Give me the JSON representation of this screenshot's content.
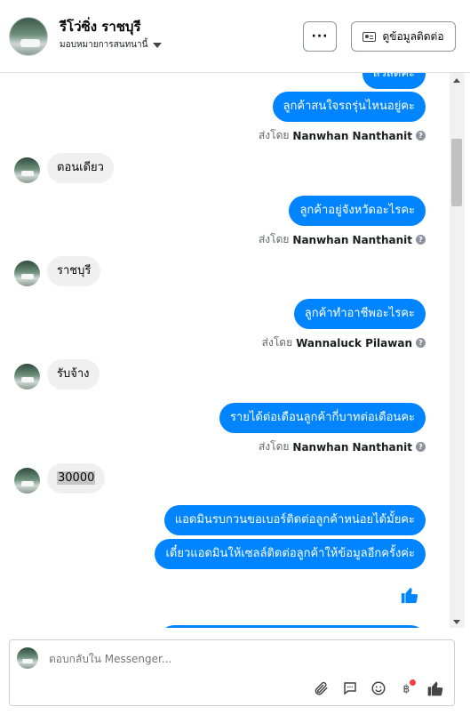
{
  "header": {
    "contact_name": "รีโว่ซิ่ง ราชบุรี",
    "assign_label": "มอบหมายการสนทนานี้",
    "more_label": "···",
    "contact_info_label": "ดูข้อมูลติดต่อ"
  },
  "thread": {
    "sent_by_prefix": "ส่งโดย",
    "messages": [
      {
        "id": "m0",
        "text": "สวัสดีค่ะ"
      },
      {
        "id": "m1",
        "text": "ลูกค้าสนใจรถรุ่นไหนอยู่คะ",
        "sender": "Nanwhan Nanthanit"
      },
      {
        "id": "m2",
        "text": "ตอนเดียว"
      },
      {
        "id": "m3",
        "text": "ลูกค้าอยู่จังหวัดอะไรคะ",
        "sender": "Nanwhan Nanthanit"
      },
      {
        "id": "m4",
        "text": "ราชบุรี"
      },
      {
        "id": "m5",
        "text": "ลูกค้าทำอาชีพอะไรคะ",
        "sender": "Wannaluck Pilawan"
      },
      {
        "id": "m6",
        "text": "รับจ้าง"
      },
      {
        "id": "m7",
        "text": "รายได้ต่อเดือนลูกค้ากี่บาทต่อเดือนคะ",
        "sender": "Nanwhan Nanthanit"
      },
      {
        "id": "m8",
        "text": "30000"
      },
      {
        "id": "m9",
        "text": "แอดมินรบกวนขอเบอร์ติดต่อลูกค้าหน่อยได้มั้ยคะ"
      },
      {
        "id": "m10",
        "text": "เดี๋ยวแอดมินให้เซลล์ติดต่อลูกค้าให้ข้อมูลอีกครั้งค่ะ"
      }
    ]
  },
  "composer": {
    "placeholder": "ตอบกลับใน Messenger..."
  },
  "colors": {
    "accent": "#0084ff",
    "incoming_bubble": "#f0f0f0",
    "notification_dot": "#fa3e3e"
  },
  "icons": [
    "attachment-icon",
    "saved-replies-icon",
    "emoji-icon",
    "payment-icon",
    "like-icon",
    "help-icon",
    "id-card-icon",
    "chevron-down-icon"
  ]
}
